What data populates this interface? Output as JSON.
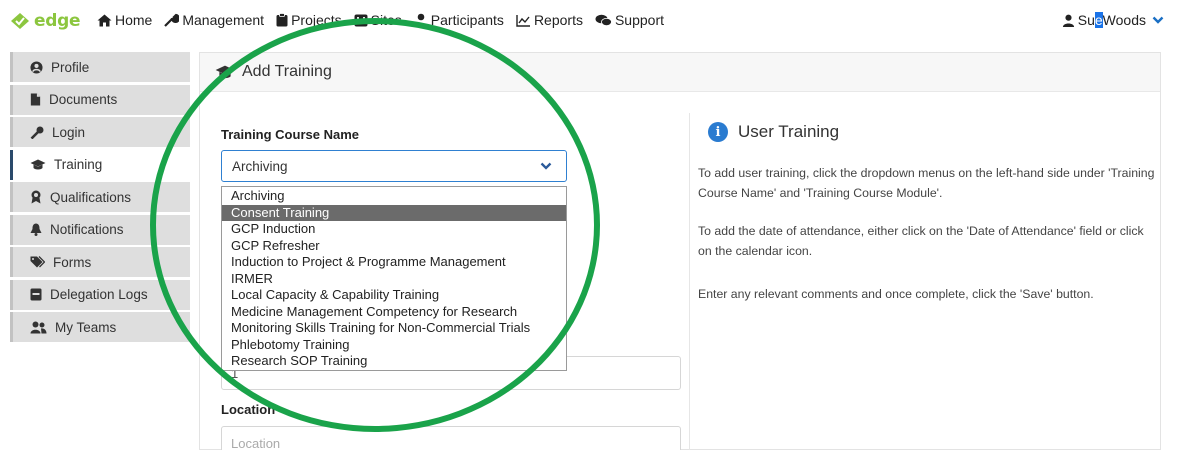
{
  "brand": {
    "name": "edge",
    "color": "#8cc63f"
  },
  "nav": [
    {
      "label": "Home",
      "icon": "home-icon"
    },
    {
      "label": "Management",
      "icon": "wrench-icon"
    },
    {
      "label": "Projects",
      "icon": "clipboard-icon"
    },
    {
      "label": "Sites",
      "icon": "hospital-icon"
    },
    {
      "label": "Participants",
      "icon": "user-icon"
    },
    {
      "label": "Reports",
      "icon": "line-chart-icon"
    },
    {
      "label": "Support",
      "icon": "comments-icon"
    }
  ],
  "user": {
    "name_prefix": "Su",
    "name_highlight": "e",
    "name_suffix": " Woods",
    "icon": "user-icon"
  },
  "sidebar": {
    "items": [
      {
        "label": "Profile",
        "icon": "user-circle-icon",
        "active": false
      },
      {
        "label": "Documents",
        "icon": "file-icon",
        "active": false
      },
      {
        "label": "Login",
        "icon": "key-icon",
        "active": false
      },
      {
        "label": "Training",
        "icon": "graduation-cap-icon",
        "active": true
      },
      {
        "label": "Qualifications",
        "icon": "award-icon",
        "active": false
      },
      {
        "label": "Notifications",
        "icon": "bell-icon",
        "active": false
      },
      {
        "label": "Forms",
        "icon": "tags-icon",
        "active": false
      },
      {
        "label": "Delegation Logs",
        "icon": "log-book-icon",
        "active": false
      },
      {
        "label": "My Teams",
        "icon": "users-icon",
        "active": false
      }
    ]
  },
  "panel": {
    "title": "Add Training",
    "course_label": "Training Course Name",
    "course_value": "Archiving",
    "course_options": [
      "Archiving",
      "Consent Training",
      "GCP Induction",
      "GCP Refresher",
      "Induction to Project & Programme Management",
      "IRMER",
      "Local Capacity & Capability Training",
      "Medicine Management Competency for Research",
      "Monitoring Skills Training for Non-Commercial Trials",
      "Phlebotomy Training",
      "Research SOP Training"
    ],
    "highlighted_option": "Consent Training",
    "hidden_field_value": "1",
    "location_label": "Location",
    "location_placeholder": "Location"
  },
  "info": {
    "title": "User Training",
    "p1": "To add user training, click the dropdown menus on the left-hand side under 'Training Course Name' and 'Training Course Module'.",
    "p2": "To add the date of attendance, either click on the 'Date of Attendance' field or click on the calendar icon.",
    "p3": "Enter any relevant comments and once complete, click the 'Save' button."
  },
  "colors": {
    "accent": "#2f80d1",
    "annotation_ring": "#1aa34a",
    "active_border": "#2a4a6b"
  }
}
